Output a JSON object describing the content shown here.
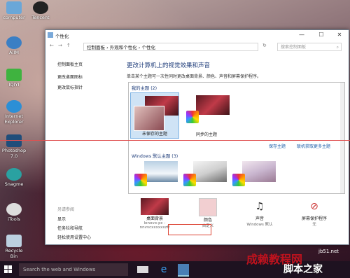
{
  "desktop": {
    "icons": [
      {
        "label": "computer"
      },
      {
        "label": "Tencent"
      },
      {
        "label": "AIIM"
      },
      {
        "label": "IQIYI"
      },
      {
        "label": "Internet Explorer"
      },
      {
        "label": "Photoshop 7.0"
      },
      {
        "label": "Snagme"
      },
      {
        "label": "iTools"
      },
      {
        "label": "Recycle Bin"
      }
    ]
  },
  "window": {
    "title": "个性化",
    "controls": {
      "minimize": "—",
      "maximize": "☐",
      "close": "✕"
    },
    "breadcrumb": "控制面板  ›  外观和个性化  ›  个性化",
    "search_placeholder": "搜索控制面板",
    "left_links": [
      "控制面板主页",
      "更改桌面图标",
      "更改鼠标指针"
    ],
    "see_also_title": "另请参阅",
    "see_also": [
      "显示",
      "任务栏和导航",
      "轻松使用设置中心"
    ],
    "heading": "更改计算机上的视觉效果和声音",
    "description": "单击某个主题可一次性同时更改桌面背景、颜色、声音和屏幕保护程序。",
    "my_themes_title": "我的主题 (2)",
    "my_themes": [
      {
        "label": "未保存的主题"
      },
      {
        "label": "同步的主题"
      }
    ],
    "save_theme": "保存主题",
    "online_themes": "联机获取更多主题",
    "windows_themes_title": "Windows 默认主题 (3)",
    "bottom": [
      {
        "label": "桌面背景",
        "value": "lenovo-pc - nnvvcxxxxxxzff"
      },
      {
        "label": "颜色",
        "value": "自定义"
      },
      {
        "label": "声音",
        "value": "Windows 默认"
      },
      {
        "label": "屏幕保护程序",
        "value": "无"
      }
    ]
  },
  "taskbar": {
    "search_placeholder": "Search the web and Windows"
  },
  "watermark": {
    "line1": "成赖教程网",
    "line2": "脚本之家",
    "line3": "jb51.net"
  },
  "colors": {
    "heading": "#1f3d7a",
    "link": "#1a5ca8",
    "selection": "#cfe3f5",
    "callout": "#dd4433"
  }
}
